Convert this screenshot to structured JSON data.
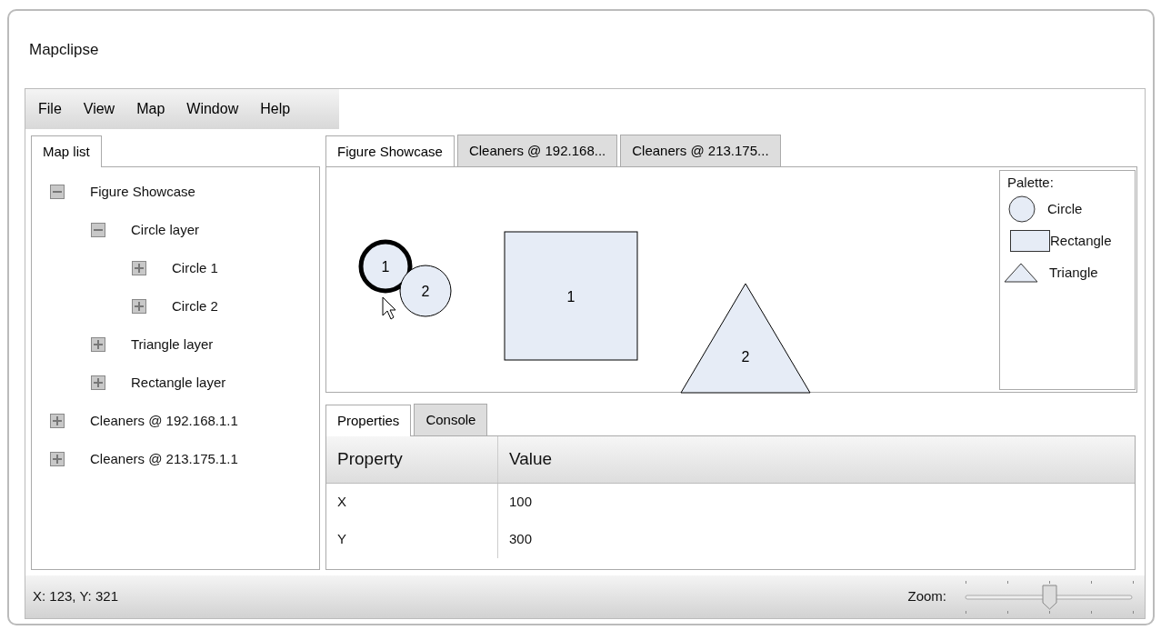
{
  "window": {
    "title": "Mapclipse"
  },
  "menu": [
    "File",
    "View",
    "Map",
    "Window",
    "Help"
  ],
  "sidebar": {
    "tabs": [
      {
        "label": "Map list",
        "selected": true
      }
    ],
    "tree": [
      {
        "label": "Figure Showcase",
        "expanded": true,
        "children": [
          {
            "label": "Circle layer",
            "expanded": true,
            "children": [
              {
                "label": "Circle 1",
                "expanded": false
              },
              {
                "label": "Circle 2",
                "expanded": false
              }
            ]
          },
          {
            "label": "Triangle layer",
            "expanded": false
          },
          {
            "label": "Rectangle layer",
            "expanded": false
          }
        ]
      },
      {
        "label": "Cleaners @ 192.168.1.1",
        "expanded": false
      },
      {
        "label": "Cleaners @ 213.175.1.1",
        "expanded": false
      }
    ]
  },
  "editor": {
    "tabs": [
      {
        "label": "Figure Showcase",
        "selected": true
      },
      {
        "label": "Cleaners @ 192.168...",
        "selected": false
      },
      {
        "label": "Cleaners @ 213.175...",
        "selected": false
      }
    ],
    "figures": [
      {
        "kind": "circle",
        "label": "1",
        "selected": true
      },
      {
        "kind": "circle",
        "label": "2",
        "selected": false
      },
      {
        "kind": "rectangle",
        "label": "1",
        "selected": false
      },
      {
        "kind": "triangle",
        "label": "2",
        "selected": false
      }
    ],
    "palette": {
      "title": "Palette:",
      "items": [
        {
          "kind": "circle",
          "label": "Circle"
        },
        {
          "kind": "rectangle",
          "label": "Rectangle"
        },
        {
          "kind": "triangle",
          "label": "Triangle"
        }
      ]
    }
  },
  "bottom": {
    "tabs": [
      {
        "label": "Properties",
        "selected": true
      },
      {
        "label": "Console",
        "selected": false
      }
    ],
    "table": {
      "columns": [
        "Property",
        "Value"
      ],
      "rows": [
        [
          "X",
          "100"
        ],
        [
          "Y",
          "300"
        ]
      ]
    }
  },
  "status_bar": {
    "position": "X: 123, Y: 321",
    "zoom_label": "Zoom:",
    "zoom": {
      "level": 0.5
    }
  }
}
